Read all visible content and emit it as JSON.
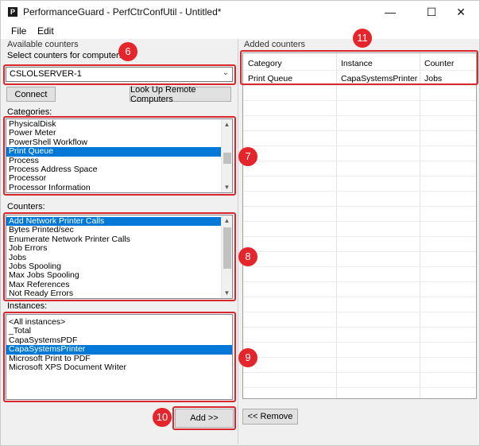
{
  "window": {
    "title": "PerformanceGuard - PerfCtrConfUtil - Untitled*",
    "icon": "app-icon",
    "controls": {
      "minimize": "—",
      "maximize": "☐",
      "close": "✕"
    }
  },
  "menu": {
    "items": [
      "File",
      "Edit"
    ]
  },
  "left": {
    "group_label": "Available counters",
    "computer_label": "Select counters for computer:",
    "computer_value": "CSLOLSERVER-1",
    "connect_label": "Connect",
    "lookup_label": "Look Up Remote Computers",
    "categories_label": "Categories:",
    "categories": [
      "PhysicalDisk",
      "Power Meter",
      "PowerShell Workflow",
      "Print Queue",
      "Process",
      "Process Address Space",
      "Processor",
      "Processor Information"
    ],
    "categories_selected": 3,
    "counters_label": "Counters:",
    "counters": [
      "Add Network Printer Calls",
      "Bytes Printed/sec",
      "Enumerate Network Printer Calls",
      "Job Errors",
      "Jobs",
      "Jobs Spooling",
      "Max Jobs Spooling",
      "Max References",
      "Not Ready Errors"
    ],
    "counters_selected": 0,
    "instances_label": "Instances:",
    "instances": [
      "<All instances>",
      "_Total",
      "CapaSystemsPDF",
      "CapaSystemsPrinter",
      "Microsoft Print to PDF",
      "Microsoft XPS Document Writer"
    ],
    "instances_selected": 3,
    "add_label": "Add >>"
  },
  "right": {
    "group_label": "Added counters",
    "columns": [
      "Category",
      "Instance",
      "Counter"
    ],
    "rows": [
      {
        "category": "Print Queue",
        "instance": "CapaSystemsPrinter",
        "counter": "Jobs"
      }
    ],
    "remove_label": "<< Remove"
  },
  "callouts": [
    "6",
    "7",
    "8",
    "9",
    "10",
    "11"
  ],
  "colors": {
    "selection": "#0078d7",
    "callout": "#e4262c",
    "highlight_box": "#d9272e"
  }
}
